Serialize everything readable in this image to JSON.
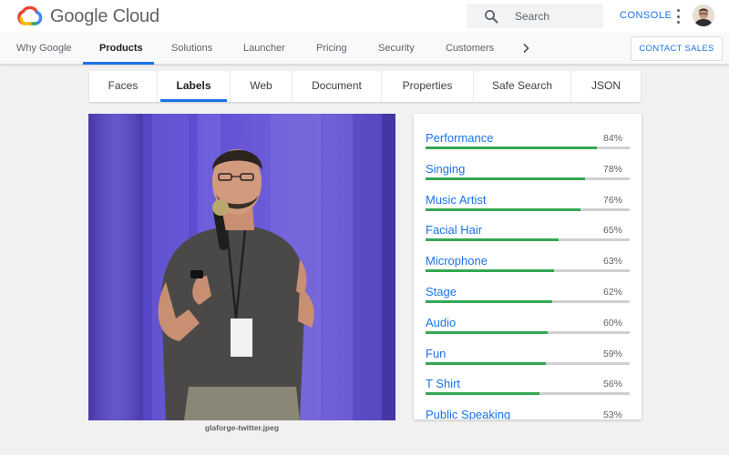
{
  "header": {
    "logo_text": "Google Cloud",
    "search_placeholder": "Search",
    "console_label": "CONSOLE"
  },
  "nav": {
    "items": [
      {
        "label": "Why Google",
        "active": false
      },
      {
        "label": "Products",
        "active": true
      },
      {
        "label": "Solutions",
        "active": false
      },
      {
        "label": "Launcher",
        "active": false
      },
      {
        "label": "Pricing",
        "active": false
      },
      {
        "label": "Security",
        "active": false
      },
      {
        "label": "Customers",
        "active": false
      }
    ],
    "contact_label": "CONTACT SALES"
  },
  "tabs": [
    {
      "label": "Faces",
      "active": false
    },
    {
      "label": "Labels",
      "active": true
    },
    {
      "label": "Web",
      "active": false
    },
    {
      "label": "Document",
      "active": false
    },
    {
      "label": "Properties",
      "active": false
    },
    {
      "label": "Safe Search",
      "active": false
    },
    {
      "label": "JSON",
      "active": false
    }
  ],
  "image": {
    "caption": "glaforge-twitter.jpeg"
  },
  "labels": [
    {
      "name": "Performance",
      "percent": "84%",
      "score": 0.84
    },
    {
      "name": "Singing",
      "percent": "78%",
      "score": 0.78
    },
    {
      "name": "Music Artist",
      "percent": "76%",
      "score": 0.76
    },
    {
      "name": "Facial Hair",
      "percent": "65%",
      "score": 0.65
    },
    {
      "name": "Microphone",
      "percent": "63%",
      "score": 0.63
    },
    {
      "name": "Stage",
      "percent": "62%",
      "score": 0.62
    },
    {
      "name": "Audio",
      "percent": "60%",
      "score": 0.6
    },
    {
      "name": "Fun",
      "percent": "59%",
      "score": 0.59
    },
    {
      "name": "T Shirt",
      "percent": "56%",
      "score": 0.56
    },
    {
      "name": "Public Speaking",
      "percent": "53%",
      "score": 0.53
    }
  ],
  "colors": {
    "accent": "#1a73e8",
    "bar_fill": "#34a853",
    "bar_track": "#d0d0d0"
  }
}
